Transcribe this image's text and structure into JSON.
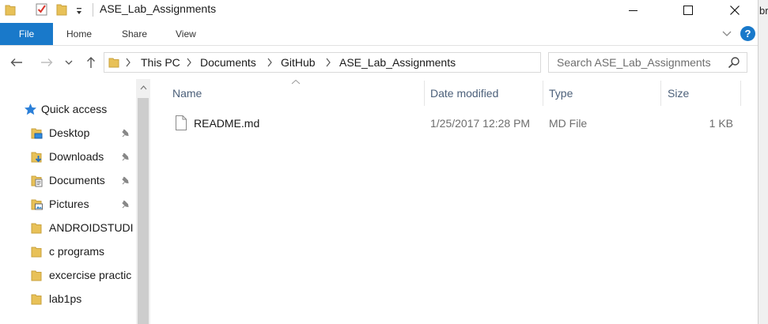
{
  "window": {
    "title": "ASE_Lab_Assignments",
    "edge_text": "br"
  },
  "ribbon": {
    "tabs": [
      {
        "label": "File",
        "active": true
      },
      {
        "label": "Home"
      },
      {
        "label": "Share"
      },
      {
        "label": "View"
      }
    ],
    "help_label": "?"
  },
  "address": {
    "crumbs": [
      "This PC",
      "Documents",
      "GitHub",
      "ASE_Lab_Assignments"
    ]
  },
  "search": {
    "placeholder": "Search ASE_Lab_Assignments"
  },
  "navigation": {
    "quick_access": "Quick access",
    "items": [
      {
        "label": "Desktop",
        "icon": "desktop-folder-icon",
        "pinned": true
      },
      {
        "label": "Downloads",
        "icon": "downloads-folder-icon",
        "pinned": true
      },
      {
        "label": "Documents",
        "icon": "documents-folder-icon",
        "pinned": true
      },
      {
        "label": "Pictures",
        "icon": "pictures-folder-icon",
        "pinned": true
      },
      {
        "label": "ANDROIDSTUDI",
        "icon": "folder-icon",
        "pinned": false
      },
      {
        "label": "c programs",
        "icon": "folder-icon",
        "pinned": false
      },
      {
        "label": "excercise practic",
        "icon": "folder-icon",
        "pinned": false
      },
      {
        "label": "lab1ps",
        "icon": "folder-icon",
        "pinned": false
      }
    ]
  },
  "columns": {
    "name": "Name",
    "date_modified": "Date modified",
    "type": "Type",
    "size": "Size"
  },
  "files": [
    {
      "name": "README.md",
      "date_modified": "1/25/2017 12:28 PM",
      "type": "MD File",
      "size": "1 KB"
    }
  ],
  "colors": {
    "accent": "#1979ca",
    "folder": "#e8c158",
    "header_text": "#4c607a"
  }
}
